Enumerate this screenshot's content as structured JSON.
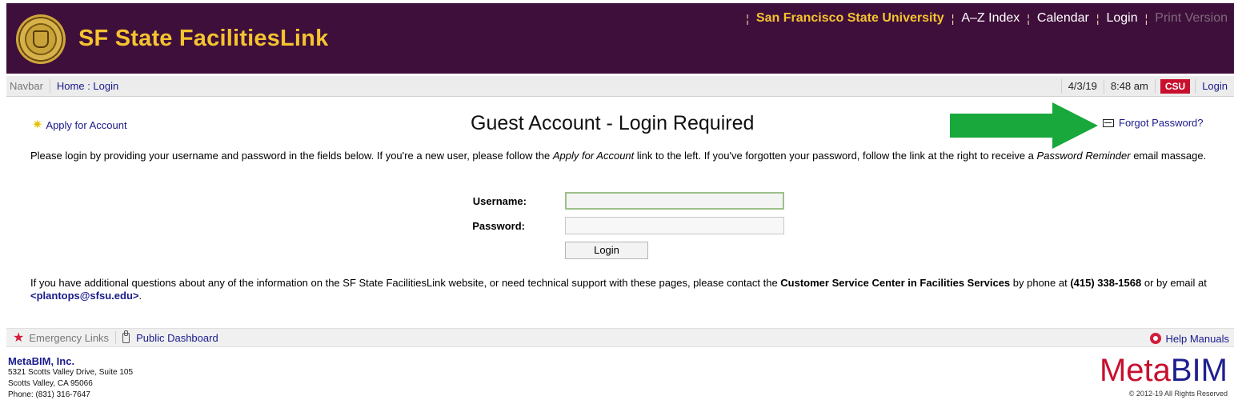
{
  "header": {
    "site_title": "SF State FacilitiesLink",
    "links": [
      {
        "label": "San Francisco State University"
      },
      {
        "label": "A–Z Index"
      },
      {
        "label": "Calendar"
      },
      {
        "label": "Login"
      },
      {
        "label": "Print Version"
      }
    ]
  },
  "navbar": {
    "label": "Navbar",
    "breadcrumb": "Home : Login",
    "date": "4/3/19",
    "time": "8:48 am",
    "badge": "CSU",
    "login": "Login"
  },
  "main": {
    "apply_link": "Apply for Account",
    "heading": "Guest Account - Login Required",
    "forgot_link": "Forgot Password?",
    "intro_1": "Please login by providing your username and password in the fields below. If you're a new user, please follow the ",
    "intro_em1": "Apply for Account",
    "intro_2": " link to the left. If you've forgotten your password, follow the link at the right to receive a ",
    "intro_em2": "Password Reminder",
    "intro_3": " email massage.",
    "username_label": "Username:",
    "username_value": "",
    "password_label": "Password:",
    "password_value": "",
    "login_button": "Login",
    "contact_1": "If you have additional questions about any of the information on the SF State FacilitiesLink website, or need technical support with these pages, please contact the ",
    "contact_bold": "Customer Service Center in Facilities Services",
    "contact_2": " by phone at ",
    "phone": "(415) 338-1568",
    "contact_3": " or by email at ",
    "email": "<plantops@sfsu.edu>",
    "contact_4": "."
  },
  "footer": {
    "emergency": "Emergency Links",
    "dashboard": "Public Dashboard",
    "help": "Help Manuals",
    "company_name": "MetaBIM, Inc.",
    "address1": "5321 Scotts Valley Drive, Suite 105",
    "address2": "Scotts Valley, CA 95066",
    "phone": "Phone: (831) 316-7647",
    "logo_meta": "Meta",
    "logo_bim": "BIM",
    "copyright": "© 2012-19 All Rights Reserved"
  },
  "colors": {
    "header_bg": "#3f0f3b",
    "title_gold": "#f4c430",
    "arrow_green": "#18a83b",
    "csu_red": "#c8102e"
  }
}
